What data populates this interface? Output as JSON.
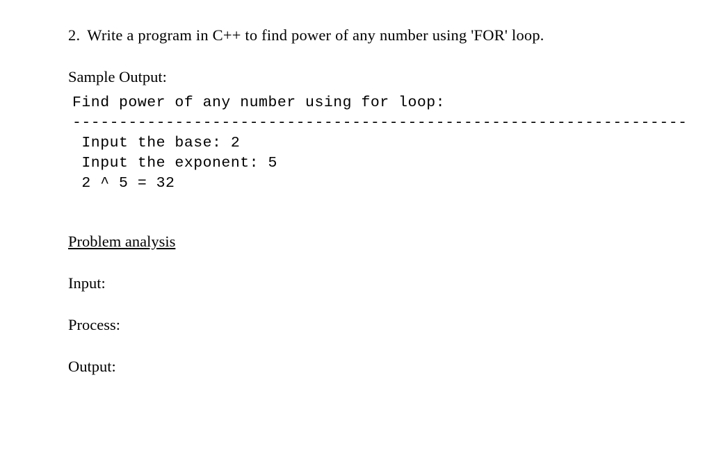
{
  "question": {
    "number": "2.",
    "text": "Write a program in C++ to find power of any number using 'FOR' loop."
  },
  "sample_output_label": "Sample Output:",
  "code": {
    "line1": "Find power of any number using for loop:",
    "line2": "------------------------------------------------------------------",
    "line3": " Input the base: 2",
    "line4": " Input the exponent: 5",
    "line5": " 2 ^ 5 = 32"
  },
  "analysis": {
    "heading": "Problem analysis",
    "input_label": "Input:",
    "process_label": "Process:",
    "output_label": "Output:"
  }
}
